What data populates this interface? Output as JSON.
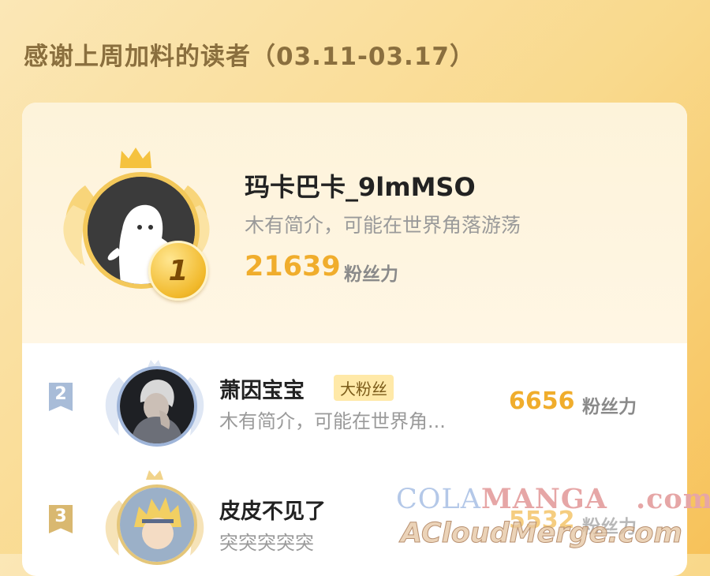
{
  "title": "感谢上周加料的读者（03.11-03.17）",
  "unit_label": "粉丝力",
  "users": [
    {
      "rank": "1",
      "name": "玛卡巴卡_9lmMSO",
      "bio": "木有简介，可能在世界角落游荡",
      "score": "21639"
    },
    {
      "rank": "2",
      "name": "萧因宝宝",
      "tag": "大粉丝",
      "bio": "木有简介，可能在世界角...",
      "score": "6656"
    },
    {
      "rank": "3",
      "name": "皮皮不见了",
      "bio": "突突突突突",
      "score": "5532"
    }
  ],
  "watermark": {
    "line1_a": "COLA",
    "line1_b": "MANGA",
    "line1_c": ".com",
    "line2": "ACloudMerge.com"
  },
  "colors": {
    "accent": "#f0ad2c",
    "gold": "#f3c85a",
    "silver": "#a8bcd8",
    "bronze": "#d9b870"
  }
}
